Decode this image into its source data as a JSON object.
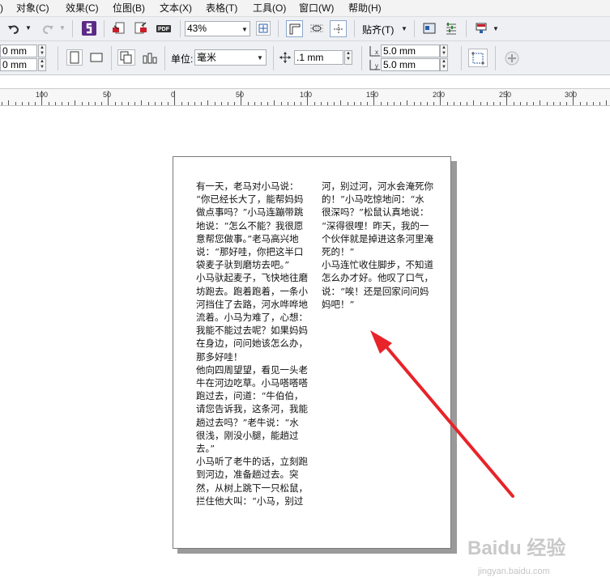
{
  "menubar": {
    "items": [
      "对象(C)",
      "效果(C)",
      "位图(B)",
      "文本(X)",
      "表格(T)",
      "工具(O)",
      "窗口(W)",
      "帮助(H)"
    ]
  },
  "toolbar1": {
    "zoom_value": "43%",
    "snap_label": "贴齐(T)"
  },
  "toolbar2": {
    "x_value": "0 mm",
    "y_value": "0 mm",
    "unit_label": "单位:",
    "unit_value": "毫米",
    "nudge_value": ".1 mm",
    "dup_x_value": "5.0 mm",
    "dup_y_value": "5.0 mm"
  },
  "ruler": {
    "labels": [
      "100",
      "50",
      "0",
      "50",
      "100",
      "150",
      "200",
      "250",
      "300"
    ]
  },
  "document": {
    "col1": [
      "有一天，老马对小马说：",
      "“你已经长大了，能帮妈妈",
      "做点事吗？”小马连蹦带跳",
      "地说：“怎么不能？我很愿",
      "意帮您做事。”老马高兴地",
      "说：“那好哇，你把这半口",
      "袋麦子驮到磨坊去吧。”",
      "小马驮起麦子，飞快地往磨",
      "坊跑去。跑着跑着，一条小",
      "河挡住了去路，河水哗哗地",
      "流着。小马为难了，心想：",
      "我能不能过去呢？如果妈妈",
      "在身边，问问她该怎么办，",
      "那多好哇！",
      "他向四周望望，看见一头老",
      "牛在河边吃草。小马嗒嗒嗒",
      "跑过去，问道：“牛伯伯，",
      "请您告诉我，这条河，我能",
      "趟过去吗？”老牛说：“水",
      "很浅，刚没小腿，能趟过",
      "去。”",
      "小马听了老牛的话，立刻跑",
      "到河边，准备趟过去。突",
      "然，从树上跳下一只松鼠，",
      "拦住他大叫：“小马，别过"
    ],
    "col2": [
      "河，别过河，河水会淹死你",
      "的！”小马吃惊地问：“水",
      "很深吗？”松鼠认真地说：",
      "“深得很哩！昨天，我的一",
      "个伙伴就是掉进这条河里淹",
      "死的！”",
      "小马连忙收住脚步，不知道",
      "怎么办才好。他叹了口气，",
      "说：“唉！还是回家问问妈",
      "妈吧！”"
    ]
  },
  "watermark": {
    "text": "Baidu 经验",
    "url": "jingyan.baidu.com"
  },
  "colors": {
    "arrow": "#e8232a",
    "menubar_bg": "#f3f3f3",
    "toolbar_bg": "#eef0f3"
  }
}
